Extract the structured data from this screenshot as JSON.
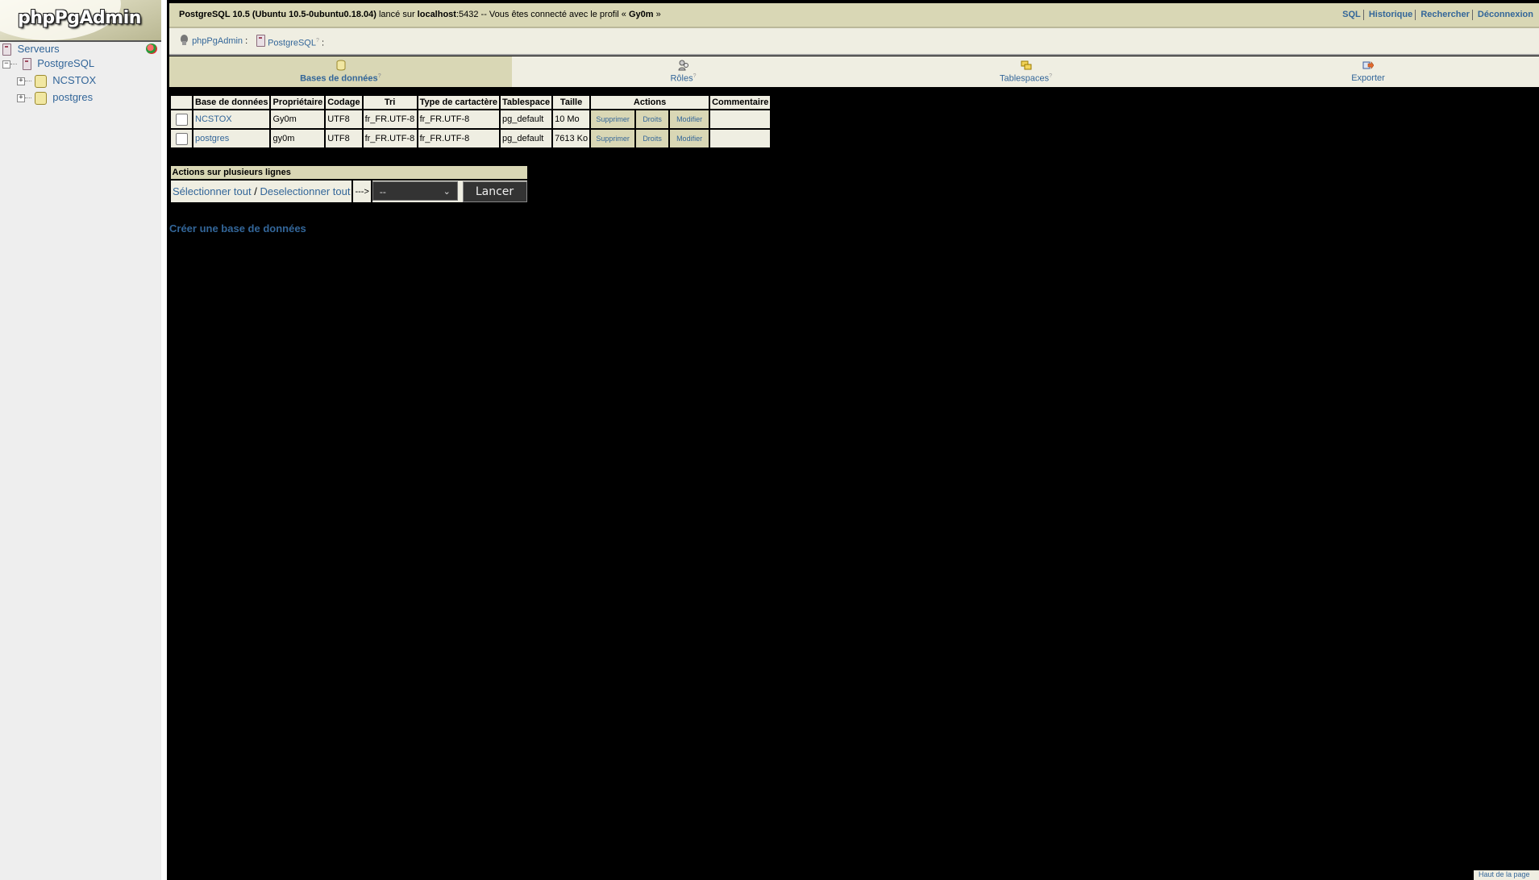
{
  "logo": {
    "text": "phpPgAdmin"
  },
  "tree": {
    "root_label": "Serveurs",
    "server_label": "PostgreSQL",
    "databases": [
      "NCSTOX",
      "postgres"
    ]
  },
  "topbar": {
    "server_version": "PostgreSQL 10.5 (Ubuntu 10.5-0ubuntu0.18.04)",
    "launched_on": "lancé sur",
    "host": "localhost",
    "port_suffix": ":5432 -- Vous êtes connecté avec le profil «",
    "user": "Gy0m",
    "user_close": "»",
    "links": {
      "sql": "SQL",
      "history": "Historique",
      "search": "Rechercher",
      "logout": "Déconnexion"
    }
  },
  "trail": {
    "app": "phpPgAdmin",
    "app_sep": ":",
    "server": "PostgreSQL",
    "help_mark": "?",
    "server_sep": ":"
  },
  "tabs": [
    {
      "label": "Bases de données",
      "help": "?",
      "icon": "database-icon",
      "active": true
    },
    {
      "label": "Rôles",
      "help": "?",
      "icon": "roles-icon",
      "active": false
    },
    {
      "label": "Tablespaces",
      "help": "?",
      "icon": "tablespaces-icon",
      "active": false
    },
    {
      "label": "Exporter",
      "help": "",
      "icon": "export-icon",
      "active": false
    }
  ],
  "table": {
    "headers": {
      "name": "Base de données",
      "owner": "Propriétaire",
      "encoding": "Codage",
      "collation": "Tri",
      "ctype": "Type de cartactère",
      "tablespace": "Tablespace",
      "size": "Taille",
      "actions": "Actions",
      "comment": "Commentaire"
    },
    "rows": [
      {
        "name": "NCSTOX",
        "owner": "Gy0m",
        "encoding": "UTF8",
        "collation": "fr_FR.UTF-8",
        "ctype": "fr_FR.UTF-8",
        "tablespace": "pg_default",
        "size": "10 Mo",
        "comment": ""
      },
      {
        "name": "postgres",
        "owner": "gy0m",
        "encoding": "UTF8",
        "collation": "fr_FR.UTF-8",
        "ctype": "fr_FR.UTF-8",
        "tablespace": "pg_default",
        "size": "7613 Ko",
        "comment": ""
      }
    ],
    "actions": {
      "drop": "Supprimer",
      "privileges": "Droits",
      "alter": "Modifier"
    }
  },
  "multi": {
    "title": "Actions sur plusieurs lignes",
    "select_all": "Sélectionner tout",
    "slash": "/",
    "unselect_all": "Deselectionner tout",
    "arrow": "--->",
    "select_value": "--",
    "go_button": "Lancer"
  },
  "create_db_link": "Créer une base de données",
  "back_to_top": "Haut de la page",
  "colors": {
    "header_bg": "#d9d7b5",
    "row_bg": "#efeee2",
    "link": "#336699",
    "background": "#000000"
  }
}
